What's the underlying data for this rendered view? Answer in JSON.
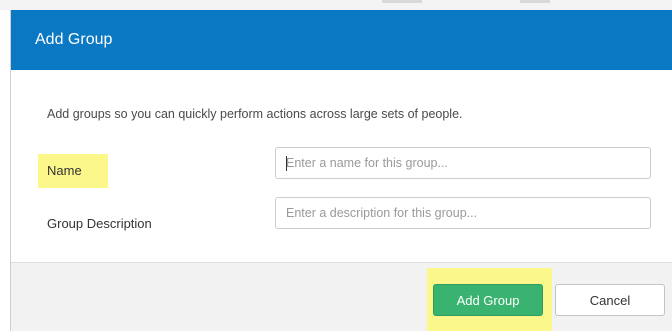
{
  "dialog": {
    "title": "Add Group",
    "intro": "Add groups so you can quickly perform actions across large sets of people.",
    "fields": {
      "name": {
        "label": "Name",
        "value": "",
        "placeholder": "Enter a name for this group..."
      },
      "description": {
        "label": "Group Description",
        "value": "",
        "placeholder": "Enter a description for this group..."
      }
    },
    "buttons": {
      "add_label": "Add Group",
      "cancel_label": "Cancel"
    }
  },
  "colors": {
    "header_bg": "#0a78c2",
    "primary_button": "#39b36f",
    "highlight": "#fbf78a",
    "footer_bg": "#f2f2f2"
  }
}
